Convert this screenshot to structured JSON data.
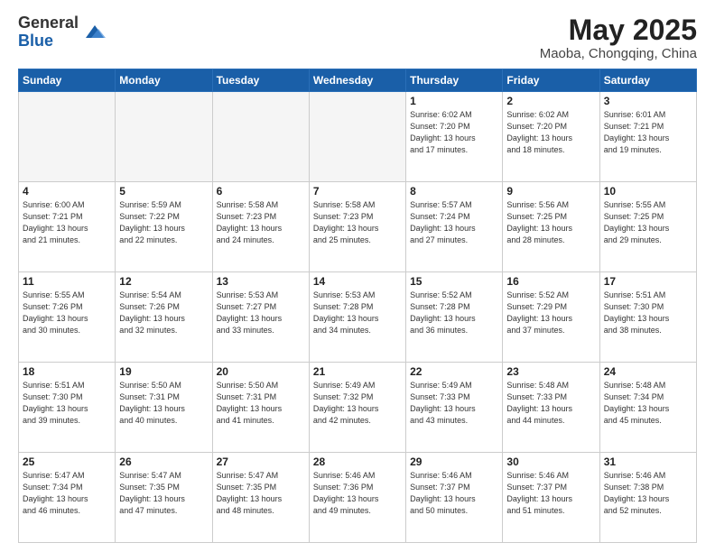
{
  "logo": {
    "general": "General",
    "blue": "Blue"
  },
  "header": {
    "title": "May 2025",
    "location": "Maoba, Chongqing, China"
  },
  "weekdays": [
    "Sunday",
    "Monday",
    "Tuesday",
    "Wednesday",
    "Thursday",
    "Friday",
    "Saturday"
  ],
  "weeks": [
    [
      {
        "day": "",
        "empty": true
      },
      {
        "day": "",
        "empty": true
      },
      {
        "day": "",
        "empty": true
      },
      {
        "day": "",
        "empty": true
      },
      {
        "day": "1",
        "sunrise": "Sunrise: 6:02 AM",
        "sunset": "Sunset: 7:20 PM",
        "daylight": "Daylight: 13 hours",
        "minutes": "and 17 minutes."
      },
      {
        "day": "2",
        "sunrise": "Sunrise: 6:02 AM",
        "sunset": "Sunset: 7:20 PM",
        "daylight": "Daylight: 13 hours",
        "minutes": "and 18 minutes."
      },
      {
        "day": "3",
        "sunrise": "Sunrise: 6:01 AM",
        "sunset": "Sunset: 7:21 PM",
        "daylight": "Daylight: 13 hours",
        "minutes": "and 19 minutes."
      }
    ],
    [
      {
        "day": "4",
        "sunrise": "Sunrise: 6:00 AM",
        "sunset": "Sunset: 7:21 PM",
        "daylight": "Daylight: 13 hours",
        "minutes": "and 21 minutes."
      },
      {
        "day": "5",
        "sunrise": "Sunrise: 5:59 AM",
        "sunset": "Sunset: 7:22 PM",
        "daylight": "Daylight: 13 hours",
        "minutes": "and 22 minutes."
      },
      {
        "day": "6",
        "sunrise": "Sunrise: 5:58 AM",
        "sunset": "Sunset: 7:23 PM",
        "daylight": "Daylight: 13 hours",
        "minutes": "and 24 minutes."
      },
      {
        "day": "7",
        "sunrise": "Sunrise: 5:58 AM",
        "sunset": "Sunset: 7:23 PM",
        "daylight": "Daylight: 13 hours",
        "minutes": "and 25 minutes."
      },
      {
        "day": "8",
        "sunrise": "Sunrise: 5:57 AM",
        "sunset": "Sunset: 7:24 PM",
        "daylight": "Daylight: 13 hours",
        "minutes": "and 27 minutes."
      },
      {
        "day": "9",
        "sunrise": "Sunrise: 5:56 AM",
        "sunset": "Sunset: 7:25 PM",
        "daylight": "Daylight: 13 hours",
        "minutes": "and 28 minutes."
      },
      {
        "day": "10",
        "sunrise": "Sunrise: 5:55 AM",
        "sunset": "Sunset: 7:25 PM",
        "daylight": "Daylight: 13 hours",
        "minutes": "and 29 minutes."
      }
    ],
    [
      {
        "day": "11",
        "sunrise": "Sunrise: 5:55 AM",
        "sunset": "Sunset: 7:26 PM",
        "daylight": "Daylight: 13 hours",
        "minutes": "and 30 minutes."
      },
      {
        "day": "12",
        "sunrise": "Sunrise: 5:54 AM",
        "sunset": "Sunset: 7:26 PM",
        "daylight": "Daylight: 13 hours",
        "minutes": "and 32 minutes."
      },
      {
        "day": "13",
        "sunrise": "Sunrise: 5:53 AM",
        "sunset": "Sunset: 7:27 PM",
        "daylight": "Daylight: 13 hours",
        "minutes": "and 33 minutes."
      },
      {
        "day": "14",
        "sunrise": "Sunrise: 5:53 AM",
        "sunset": "Sunset: 7:28 PM",
        "daylight": "Daylight: 13 hours",
        "minutes": "and 34 minutes."
      },
      {
        "day": "15",
        "sunrise": "Sunrise: 5:52 AM",
        "sunset": "Sunset: 7:28 PM",
        "daylight": "Daylight: 13 hours",
        "minutes": "and 36 minutes."
      },
      {
        "day": "16",
        "sunrise": "Sunrise: 5:52 AM",
        "sunset": "Sunset: 7:29 PM",
        "daylight": "Daylight: 13 hours",
        "minutes": "and 37 minutes."
      },
      {
        "day": "17",
        "sunrise": "Sunrise: 5:51 AM",
        "sunset": "Sunset: 7:30 PM",
        "daylight": "Daylight: 13 hours",
        "minutes": "and 38 minutes."
      }
    ],
    [
      {
        "day": "18",
        "sunrise": "Sunrise: 5:51 AM",
        "sunset": "Sunset: 7:30 PM",
        "daylight": "Daylight: 13 hours",
        "minutes": "and 39 minutes."
      },
      {
        "day": "19",
        "sunrise": "Sunrise: 5:50 AM",
        "sunset": "Sunset: 7:31 PM",
        "daylight": "Daylight: 13 hours",
        "minutes": "and 40 minutes."
      },
      {
        "day": "20",
        "sunrise": "Sunrise: 5:50 AM",
        "sunset": "Sunset: 7:31 PM",
        "daylight": "Daylight: 13 hours",
        "minutes": "and 41 minutes."
      },
      {
        "day": "21",
        "sunrise": "Sunrise: 5:49 AM",
        "sunset": "Sunset: 7:32 PM",
        "daylight": "Daylight: 13 hours",
        "minutes": "and 42 minutes."
      },
      {
        "day": "22",
        "sunrise": "Sunrise: 5:49 AM",
        "sunset": "Sunset: 7:33 PM",
        "daylight": "Daylight: 13 hours",
        "minutes": "and 43 minutes."
      },
      {
        "day": "23",
        "sunrise": "Sunrise: 5:48 AM",
        "sunset": "Sunset: 7:33 PM",
        "daylight": "Daylight: 13 hours",
        "minutes": "and 44 minutes."
      },
      {
        "day": "24",
        "sunrise": "Sunrise: 5:48 AM",
        "sunset": "Sunset: 7:34 PM",
        "daylight": "Daylight: 13 hours",
        "minutes": "and 45 minutes."
      }
    ],
    [
      {
        "day": "25",
        "sunrise": "Sunrise: 5:47 AM",
        "sunset": "Sunset: 7:34 PM",
        "daylight": "Daylight: 13 hours",
        "minutes": "and 46 minutes."
      },
      {
        "day": "26",
        "sunrise": "Sunrise: 5:47 AM",
        "sunset": "Sunset: 7:35 PM",
        "daylight": "Daylight: 13 hours",
        "minutes": "and 47 minutes."
      },
      {
        "day": "27",
        "sunrise": "Sunrise: 5:47 AM",
        "sunset": "Sunset: 7:35 PM",
        "daylight": "Daylight: 13 hours",
        "minutes": "and 48 minutes."
      },
      {
        "day": "28",
        "sunrise": "Sunrise: 5:46 AM",
        "sunset": "Sunset: 7:36 PM",
        "daylight": "Daylight: 13 hours",
        "minutes": "and 49 minutes."
      },
      {
        "day": "29",
        "sunrise": "Sunrise: 5:46 AM",
        "sunset": "Sunset: 7:37 PM",
        "daylight": "Daylight: 13 hours",
        "minutes": "and 50 minutes."
      },
      {
        "day": "30",
        "sunrise": "Sunrise: 5:46 AM",
        "sunset": "Sunset: 7:37 PM",
        "daylight": "Daylight: 13 hours",
        "minutes": "and 51 minutes."
      },
      {
        "day": "31",
        "sunrise": "Sunrise: 5:46 AM",
        "sunset": "Sunset: 7:38 PM",
        "daylight": "Daylight: 13 hours",
        "minutes": "and 52 minutes."
      }
    ]
  ]
}
